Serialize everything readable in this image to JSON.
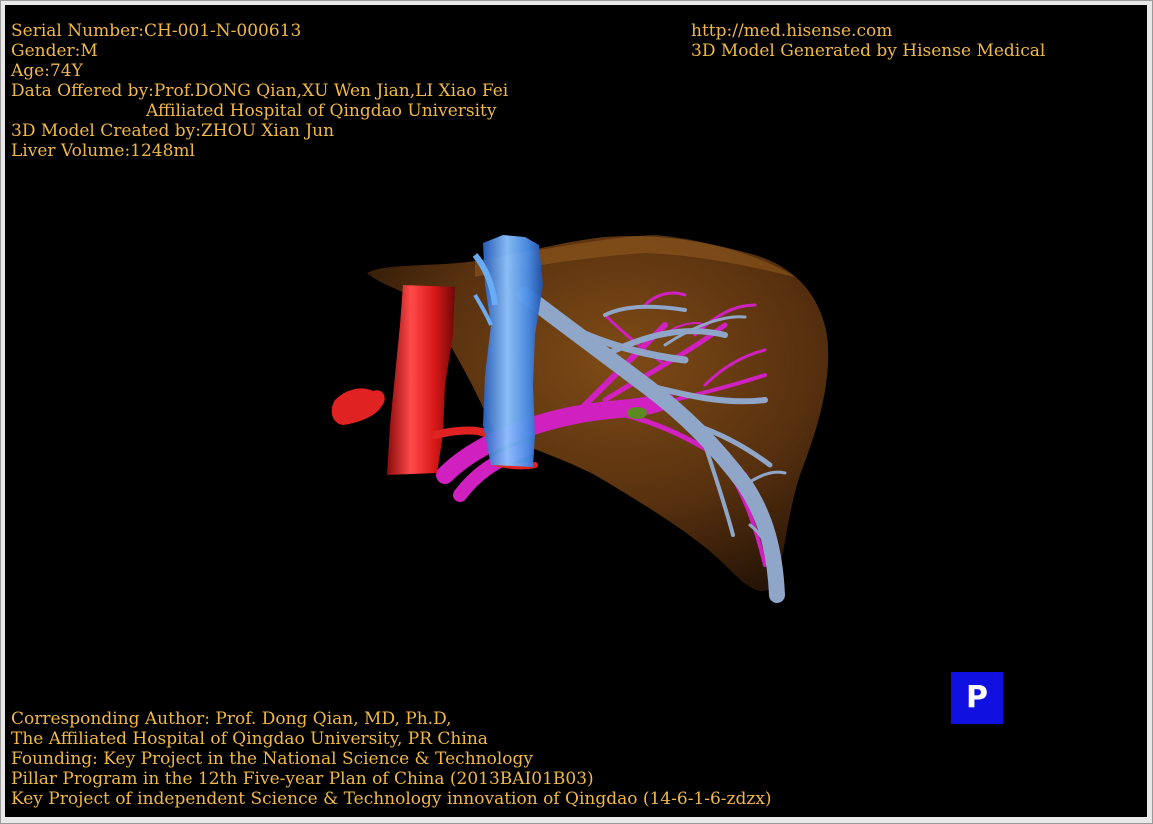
{
  "patient_info": {
    "serial": "Serial Number:CH-001-N-000613",
    "gender": "Gender:M",
    "age": "Age:74Y",
    "data_offered": "Data Offered by:Prof.DONG Qian,XU Wen Jian,LI Xiao Fei",
    "hospital": "Affiliated Hospital of Qingdao University",
    "model_created": "3D Model Created by:ZHOU Xian Jun",
    "liver_volume": "Liver Volume:1248ml"
  },
  "header_right": {
    "url": "http://med.hisense.com",
    "generated_by": "3D Model Generated by Hisense Medical"
  },
  "footer": {
    "line1": "Corresponding Author: Prof. Dong Qian, MD, Ph.D,",
    "line2": "The Affiliated Hospital of Qingdao University, PR China",
    "line3": "Founding: Key Project in the National Science & Technology",
    "line4": "Pillar Program in the 12th Five-year Plan of China (2013BAI01B03)",
    "line5": "Key Project of independent Science & Technology innovation of Qingdao (14-6-1-6-zdzx)"
  },
  "controls": {
    "p_button_label": "P"
  },
  "colors": {
    "text": "#f0b84a",
    "background": "#000000",
    "liver": "#6b3d0e",
    "aorta": "#e02020",
    "vena_cava": "#5aa0f0",
    "portal_vein": "#8fa6c8",
    "hepatic_artery": "#d020c0",
    "p_button": "#1010e0"
  }
}
